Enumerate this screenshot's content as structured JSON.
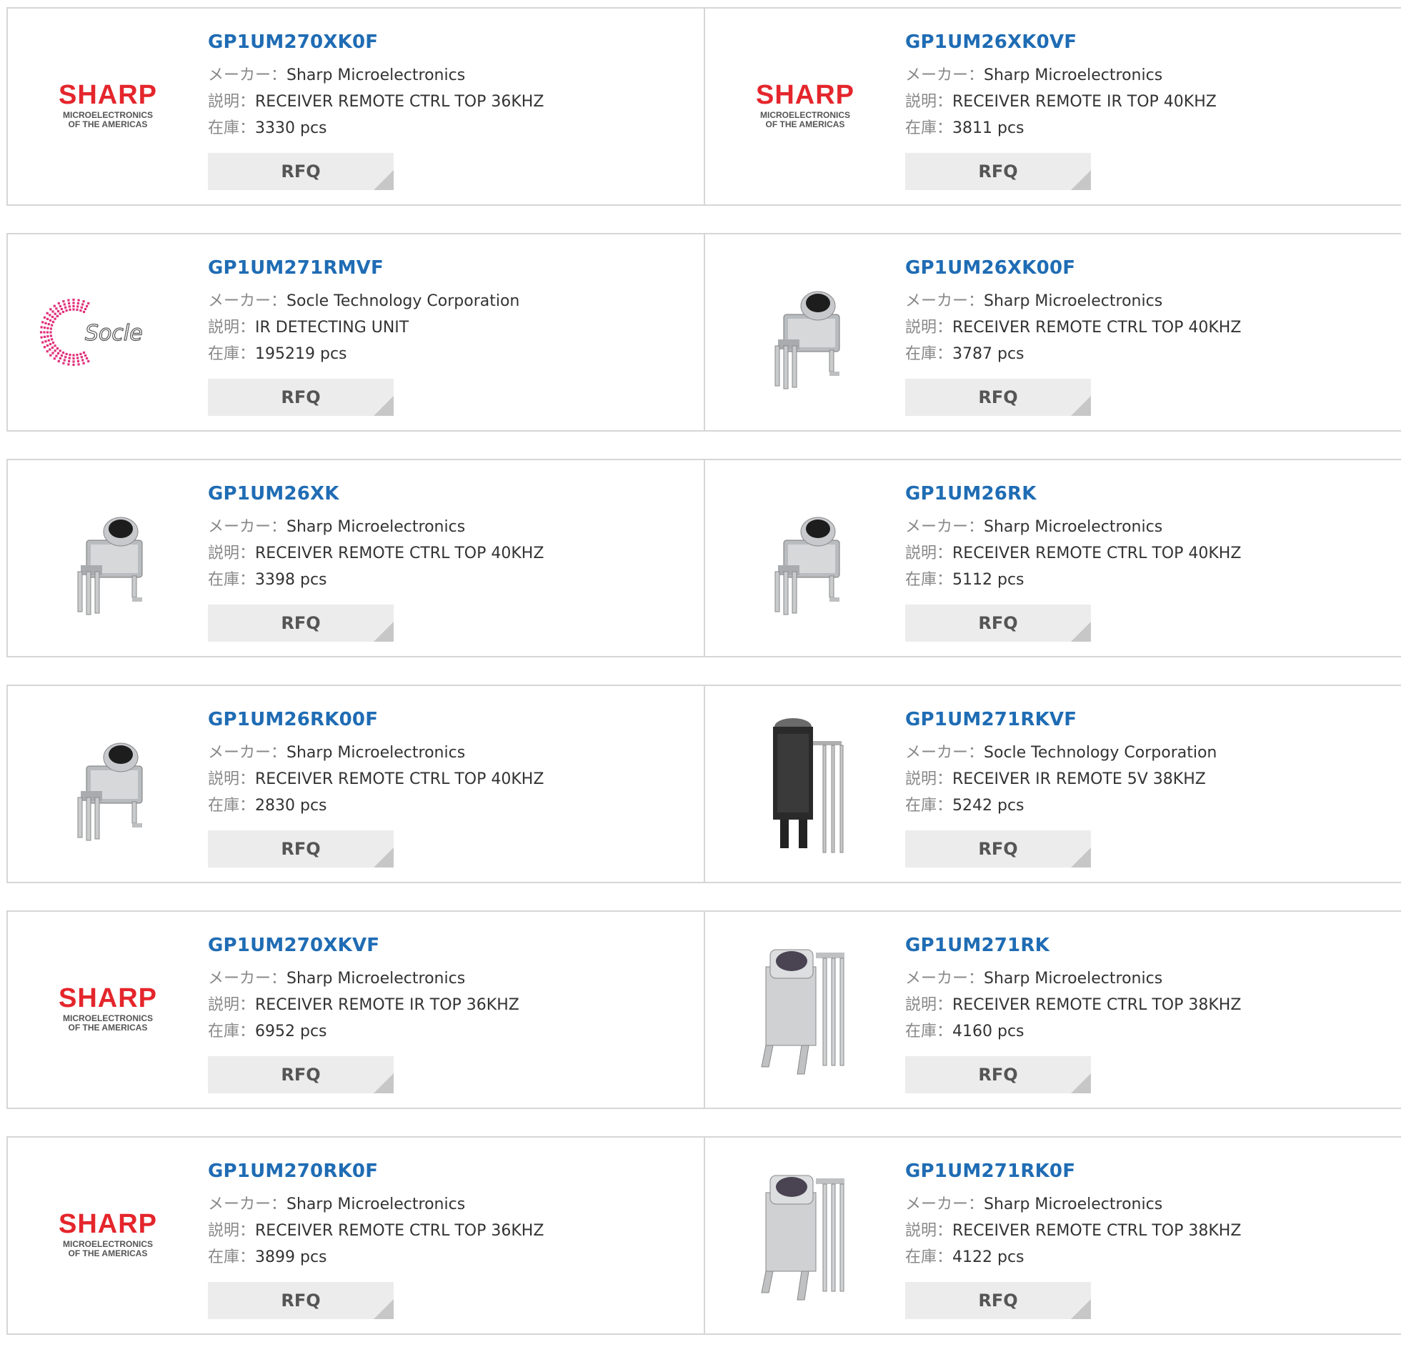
{
  "labels": {
    "maker": "メーカー：",
    "description": "説明：",
    "stock": "在庫：",
    "rfq": "RFQ"
  },
  "logos": {
    "sharp": {
      "brand": "SHARP",
      "sub1": "MICROELECTRONICS",
      "sub2": "OF THE AMERICAS",
      "color": "#e4262c"
    },
    "socle": {
      "brand": "Socle",
      "color": "#e0307a"
    }
  },
  "products": [
    {
      "part": "GP1UM270XK0F",
      "maker": "Sharp Microelectronics",
      "description": "RECEIVER REMOTE CTRL TOP 36KHZ",
      "stock": "3330 pcs",
      "image": "sharp-logo"
    },
    {
      "part": "GP1UM26XK0VF",
      "maker": "Sharp Microelectronics",
      "description": "RECEIVER REMOTE IR TOP 40KHZ",
      "stock": "3811 pcs",
      "image": "sharp-logo"
    },
    {
      "part": "GP1UM271RMVF",
      "maker": "Socle Technology Corporation",
      "description": "IR DETECTING UNIT",
      "stock": "195219 pcs",
      "image": "socle-logo"
    },
    {
      "part": "GP1UM26XK00F",
      "maker": "Sharp Microelectronics",
      "description": "RECEIVER REMOTE CTRL TOP 40KHZ",
      "stock": "3787 pcs",
      "image": "ir-receiver-photo"
    },
    {
      "part": "GP1UM26XK",
      "maker": "Sharp Microelectronics",
      "description": "RECEIVER REMOTE CTRL TOP 40KHZ",
      "stock": "3398 pcs",
      "image": "ir-receiver-photo"
    },
    {
      "part": "GP1UM26RK",
      "maker": "Sharp Microelectronics",
      "description": "RECEIVER REMOTE CTRL TOP 40KHZ",
      "stock": "5112 pcs",
      "image": "ir-receiver-photo"
    },
    {
      "part": "GP1UM26RK00F",
      "maker": "Sharp Microelectronics",
      "description": "RECEIVER REMOTE CTRL TOP 40KHZ",
      "stock": "2830 pcs",
      "image": "ir-receiver-photo"
    },
    {
      "part": "GP1UM271RKVF",
      "maker": "Socle Technology Corporation",
      "description": "RECEIVER IR REMOTE 5V 38KHZ",
      "stock": "5242 pcs",
      "image": "ir-receiver-black-photo"
    },
    {
      "part": "GP1UM270XKVF",
      "maker": "Sharp Microelectronics",
      "description": "RECEIVER REMOTE IR TOP 36KHZ",
      "stock": "6952 pcs",
      "image": "sharp-logo"
    },
    {
      "part": "GP1UM271RK",
      "maker": "Sharp Microelectronics",
      "description": "RECEIVER REMOTE CTRL TOP 38KHZ",
      "stock": "4160 pcs",
      "image": "ir-receiver-tall-photo"
    },
    {
      "part": "GP1UM270RK0F",
      "maker": "Sharp Microelectronics",
      "description": "RECEIVER REMOTE CTRL TOP 36KHZ",
      "stock": "3899 pcs",
      "image": "sharp-logo"
    },
    {
      "part": "GP1UM271RK0F",
      "maker": "Sharp Microelectronics",
      "description": "RECEIVER REMOTE CTRL TOP 38KHZ",
      "stock": "4122 pcs",
      "image": "ir-receiver-tall-photo"
    }
  ]
}
